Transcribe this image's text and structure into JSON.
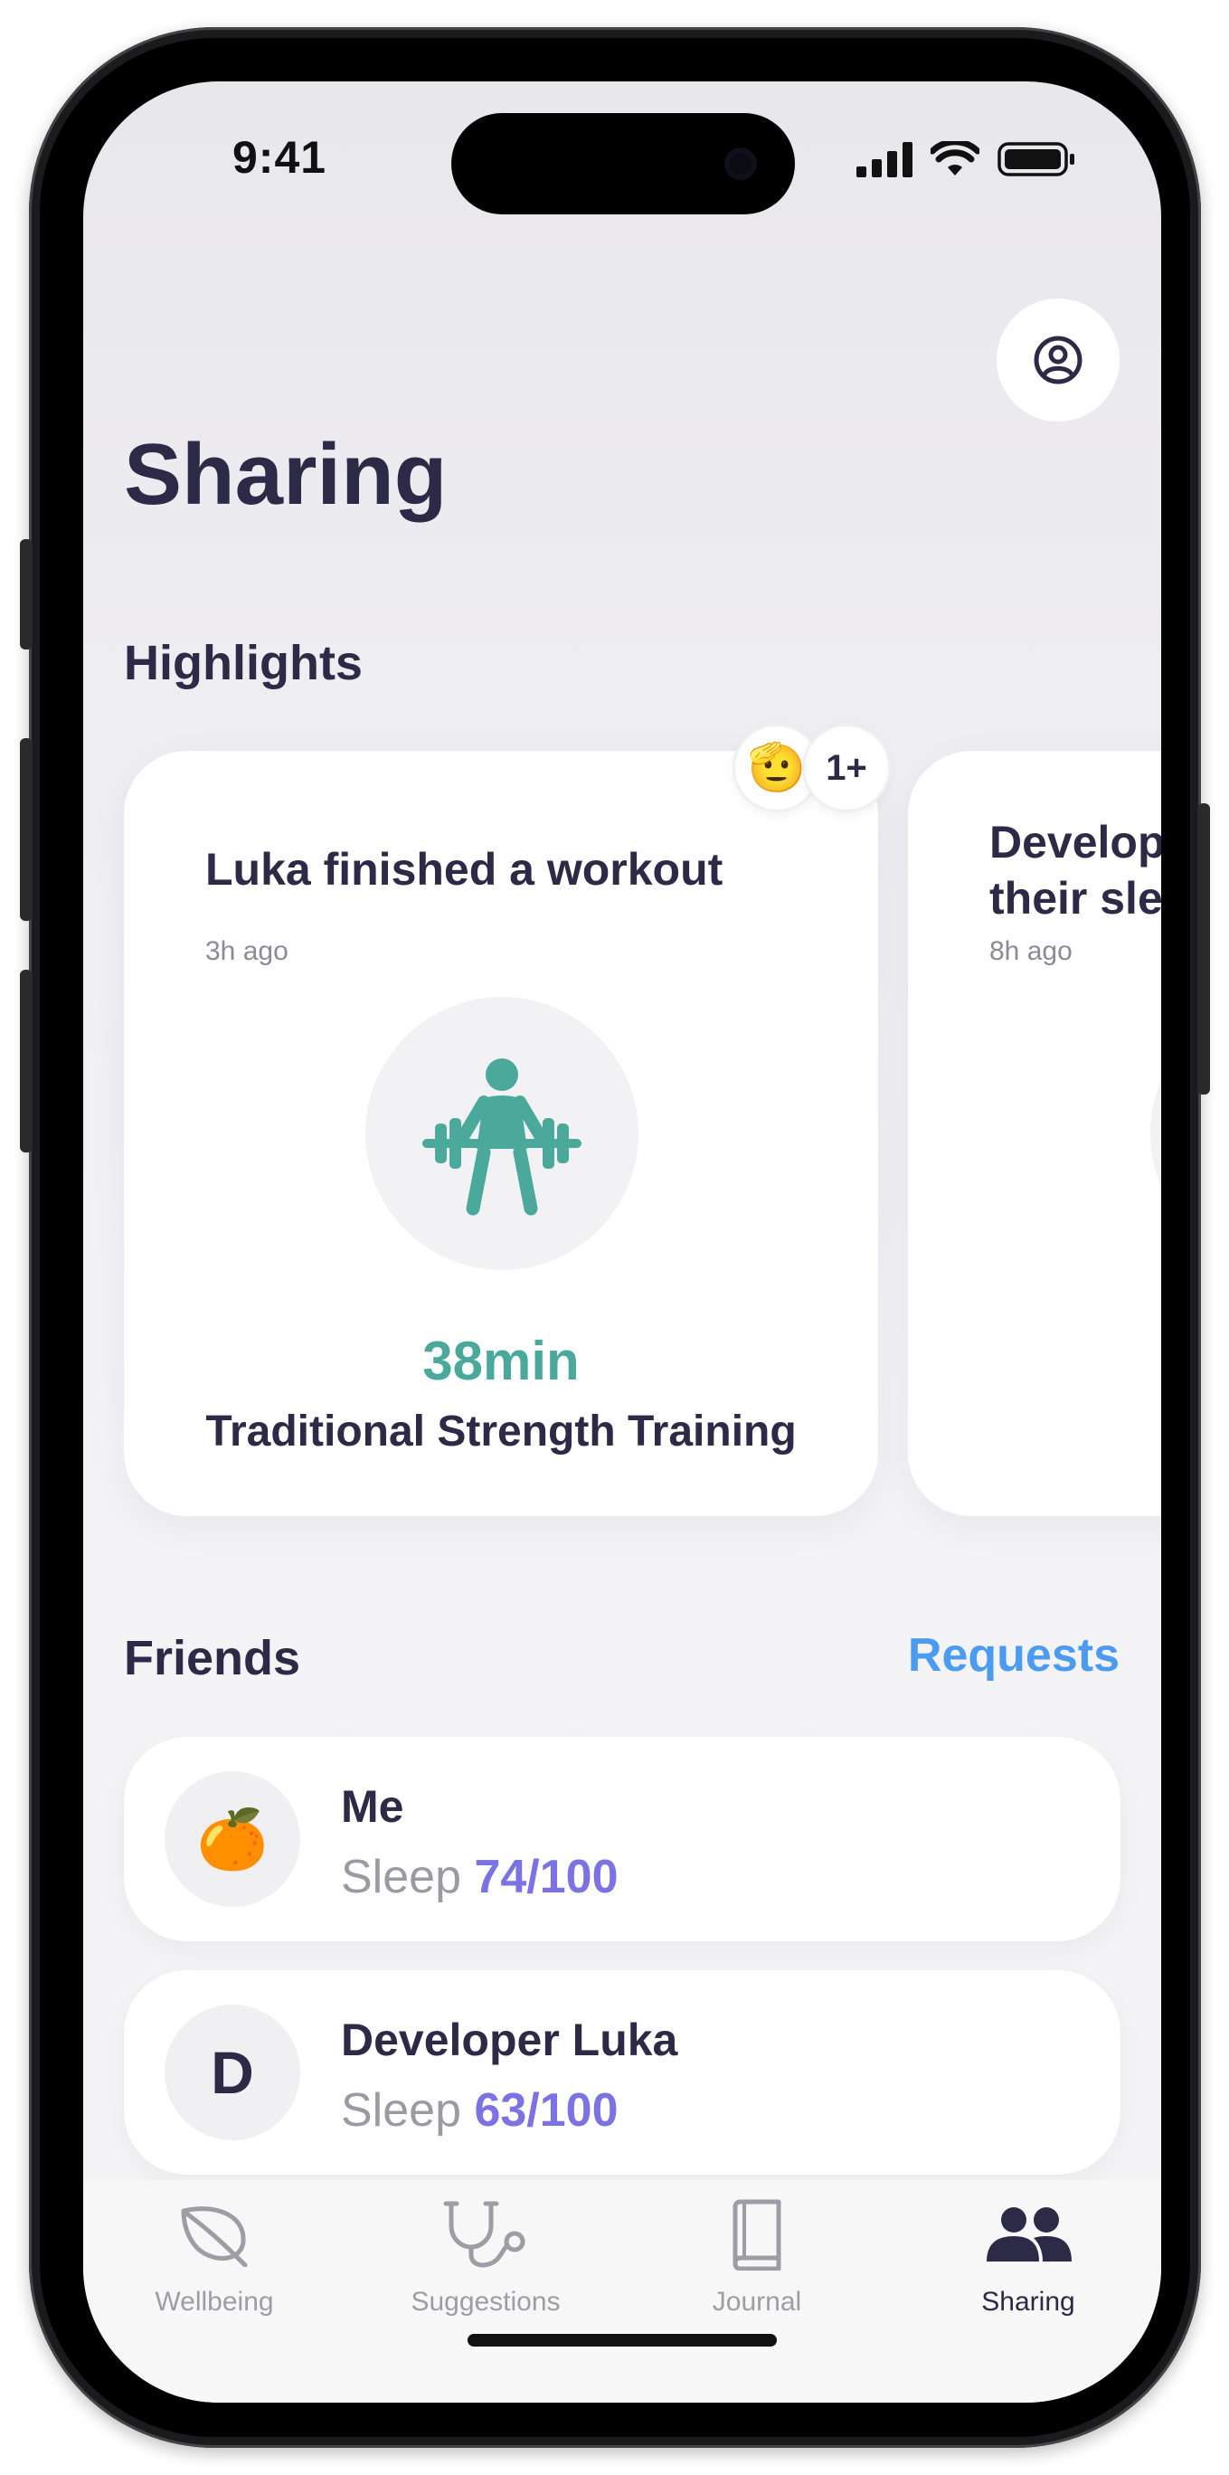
{
  "status_bar": {
    "time": "9:41",
    "icons": [
      "cellular-signal-icon",
      "wifi-icon",
      "battery-icon"
    ]
  },
  "header": {
    "title": "Sharing",
    "profile_icon": "person-circle-icon"
  },
  "highlights": {
    "title": "Highlights",
    "cards": [
      {
        "title": "Luka finished a workout",
        "time": "3h ago",
        "icon": "weightlifting-icon",
        "duration": "38min",
        "activity": "Traditional Strength Training",
        "reactions": {
          "emoji": "🫡",
          "count": "1+"
        }
      },
      {
        "title_line_1": "Develop",
        "title_line_2": "their sle",
        "time": "8h ago"
      }
    ]
  },
  "friends": {
    "title": "Friends",
    "requests_label": "Requests",
    "items": [
      {
        "avatar": "🍊",
        "name": "Me",
        "metric_label": "Sleep ",
        "score": "74/100"
      },
      {
        "avatar": "D",
        "name": "Developer Luka",
        "metric_label": "Sleep ",
        "score": "63/100"
      }
    ]
  },
  "tab_bar": {
    "items": [
      {
        "label": "Wellbeing",
        "icon": "leaf-icon",
        "active": false
      },
      {
        "label": "Suggestions",
        "icon": "stethoscope-icon",
        "active": false
      },
      {
        "label": "Journal",
        "icon": "book-icon",
        "active": false
      },
      {
        "label": "Sharing",
        "icon": "people-icon",
        "active": true
      }
    ]
  },
  "colors": {
    "accent_teal": "#4aa99a",
    "accent_purple": "#7b73e4",
    "link_blue": "#4b9cf0",
    "text_dark": "#2d2a47"
  }
}
